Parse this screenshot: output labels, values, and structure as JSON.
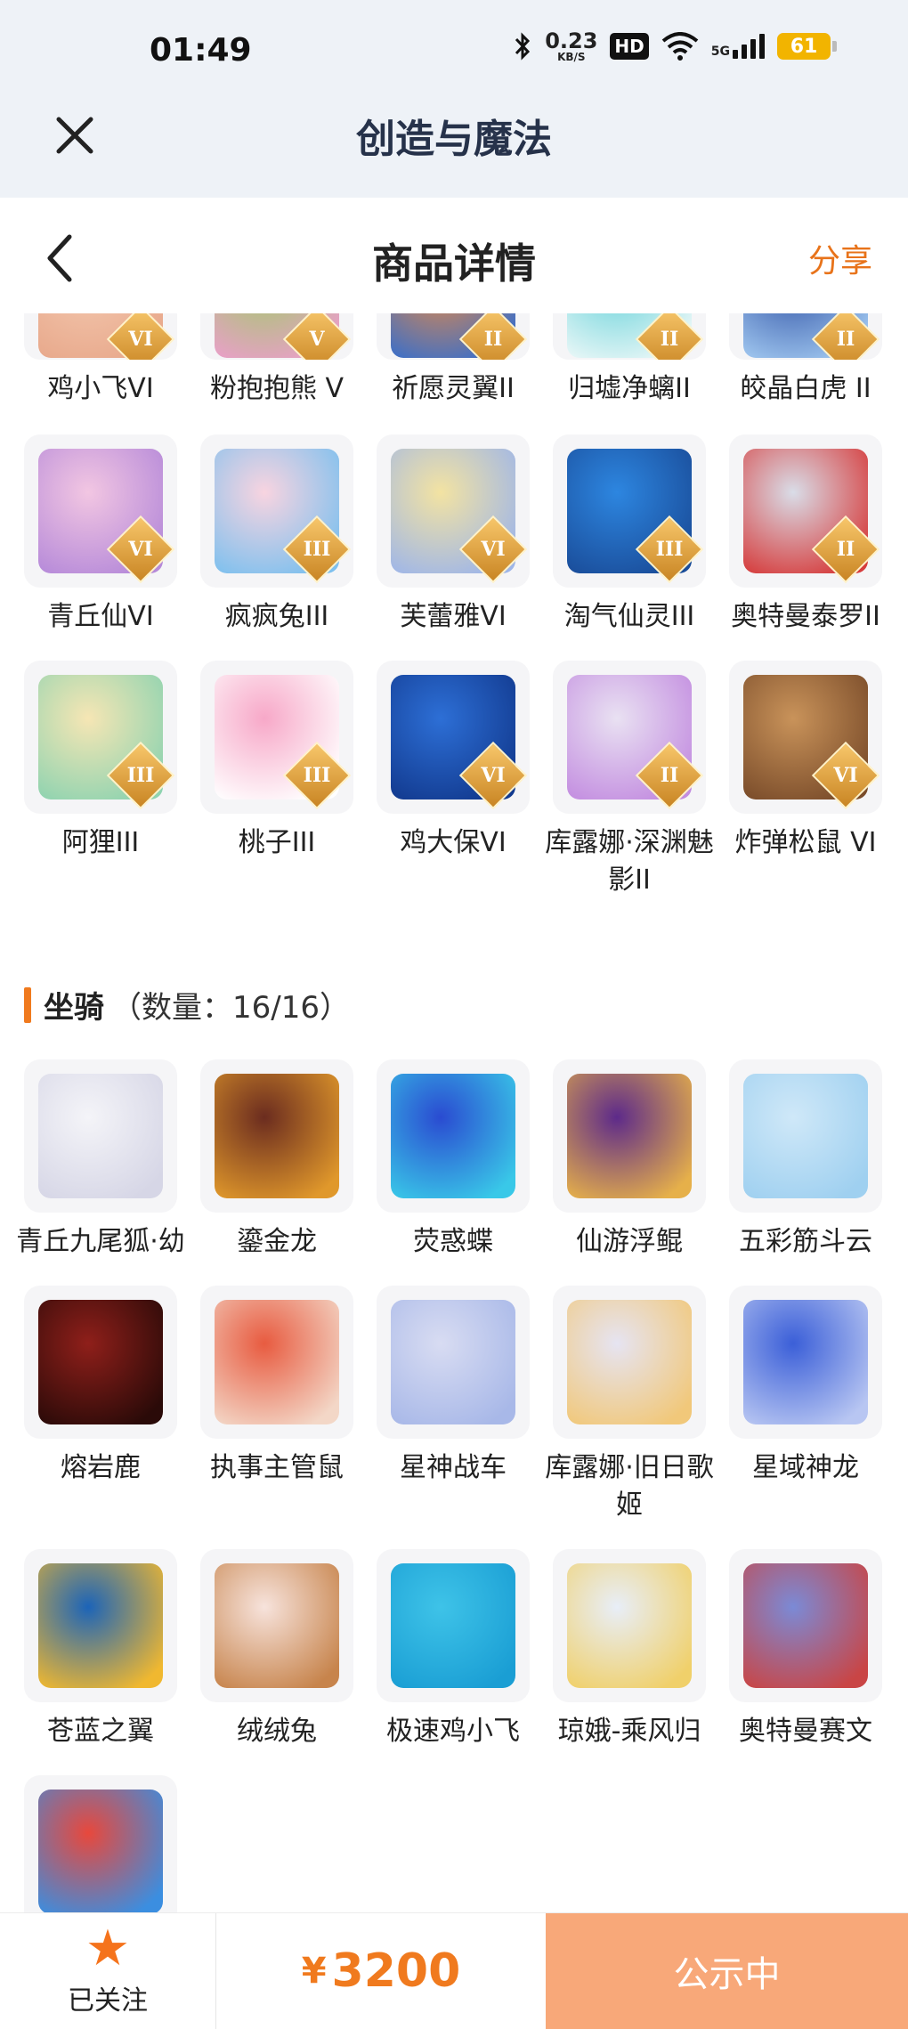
{
  "status_bar": {
    "time": "01:49",
    "speed_value": "0.23",
    "speed_unit": "KB/S",
    "hd": "HD",
    "network": "5G",
    "battery": "61"
  },
  "app_bar": {
    "close_icon": "close-icon",
    "title": "创造与魔法"
  },
  "sub_bar": {
    "back_icon": "chevron-left-icon",
    "title": "商品详情",
    "share": "分享"
  },
  "pets_partial": [
    {
      "name": "鸡小飞VI",
      "badge": "VI",
      "colors": [
        "#f4c9b0",
        "#e8a98c"
      ]
    },
    {
      "name": "粉抱抱熊 V",
      "badge": "V",
      "colors": [
        "#9ccc65",
        "#e9a0c8"
      ]
    },
    {
      "name": "祈愿灵翼II",
      "badge": "II",
      "colors": [
        "#f28b3c",
        "#3b6fc9"
      ]
    },
    {
      "name": "归墟净螭II",
      "badge": "II",
      "colors": [
        "#5fd0d8",
        "#e9f7f7"
      ]
    },
    {
      "name": "皎晶白虎 II",
      "badge": "II",
      "colors": [
        "#2d4fa3",
        "#9fc6ef"
      ]
    }
  ],
  "pets": [
    {
      "name": "青丘仙VI",
      "badge": "VI",
      "colors": [
        "#f2c6e2",
        "#b68ad9"
      ]
    },
    {
      "name": "疯疯兔III",
      "badge": "III",
      "colors": [
        "#f8d4e0",
        "#7ec0ee"
      ]
    },
    {
      "name": "芙蕾雅VI",
      "badge": "VI",
      "colors": [
        "#f3e3a2",
        "#9fb6e8"
      ]
    },
    {
      "name": "淘气仙灵III",
      "badge": "III",
      "colors": [
        "#2d86e0",
        "#1a4d9a"
      ]
    },
    {
      "name": "奥特曼泰罗II",
      "badge": "II",
      "colors": [
        "#d9dde8",
        "#d63c3c"
      ]
    },
    {
      "name": "阿狸III",
      "badge": "III",
      "colors": [
        "#f6e6b4",
        "#8fd3b0"
      ]
    },
    {
      "name": "桃子III",
      "badge": "III",
      "colors": [
        "#f7a8c8",
        "#ffffff"
      ]
    },
    {
      "name": "鸡大保VI",
      "badge": "VI",
      "colors": [
        "#2d6fd6",
        "#123a8f"
      ]
    },
    {
      "name": "库露娜·深渊魅影II",
      "badge": "II",
      "colors": [
        "#e9e1f2",
        "#c38de0"
      ]
    },
    {
      "name": "炸弹松鼠 VI",
      "badge": "VI",
      "colors": [
        "#c9935a",
        "#7a4c2a"
      ]
    }
  ],
  "mounts_section": {
    "title": "坐骑",
    "count": "（数量：16/16）"
  },
  "mounts": [
    {
      "name": "青丘九尾狐·幼",
      "colors": [
        "#f4f4f8",
        "#d6d6e6"
      ]
    },
    {
      "name": "鎏金龙",
      "colors": [
        "#6b2c1f",
        "#e0982b"
      ]
    },
    {
      "name": "荧惑蝶",
      "colors": [
        "#2a4bd1",
        "#39c8e8"
      ]
    },
    {
      "name": "仙游浮鲲",
      "colors": [
        "#5d2a8a",
        "#e6b04a"
      ]
    },
    {
      "name": "五彩筋斗云",
      "colors": [
        "#cfe8f8",
        "#9fd0f0"
      ]
    },
    {
      "name": "熔岩鹿",
      "colors": [
        "#8f1f1a",
        "#2a0a08"
      ]
    },
    {
      "name": "执事主管鼠",
      "colors": [
        "#e85b40",
        "#f3d7c7"
      ]
    },
    {
      "name": "星神战车",
      "colors": [
        "#d8dcf2",
        "#a8b8e8"
      ]
    },
    {
      "name": "库露娜·旧日歌姬",
      "colors": [
        "#e6e4f2",
        "#f1c87a"
      ]
    },
    {
      "name": "星域神龙",
      "colors": [
        "#3b5fd8",
        "#b8c6f2"
      ]
    },
    {
      "name": "苍蓝之翼",
      "colors": [
        "#1c64b8",
        "#f0b830"
      ]
    },
    {
      "name": "绒绒兔",
      "colors": [
        "#f7e3dc",
        "#c7844c"
      ]
    },
    {
      "name": "极速鸡小飞",
      "colors": [
        "#3ec3e8",
        "#1a9ed4"
      ]
    },
    {
      "name": "琼娥-乘风归",
      "colors": [
        "#e8eef8",
        "#f0d06a"
      ]
    },
    {
      "name": "奥特曼赛文",
      "colors": [
        "#7b8ad6",
        "#c94545"
      ]
    },
    {
      "name": "",
      "colors": [
        "#e8483c",
        "#3b8ee0"
      ]
    }
  ],
  "bottom_bar": {
    "follow_icon": "star-icon",
    "follow_label": "已关注",
    "currency": "¥",
    "price": "3200",
    "status": "公示中"
  },
  "colors": {
    "accent": "#f07a1e",
    "status_button": "#f8a879",
    "header_bg": "#eef2f7"
  }
}
